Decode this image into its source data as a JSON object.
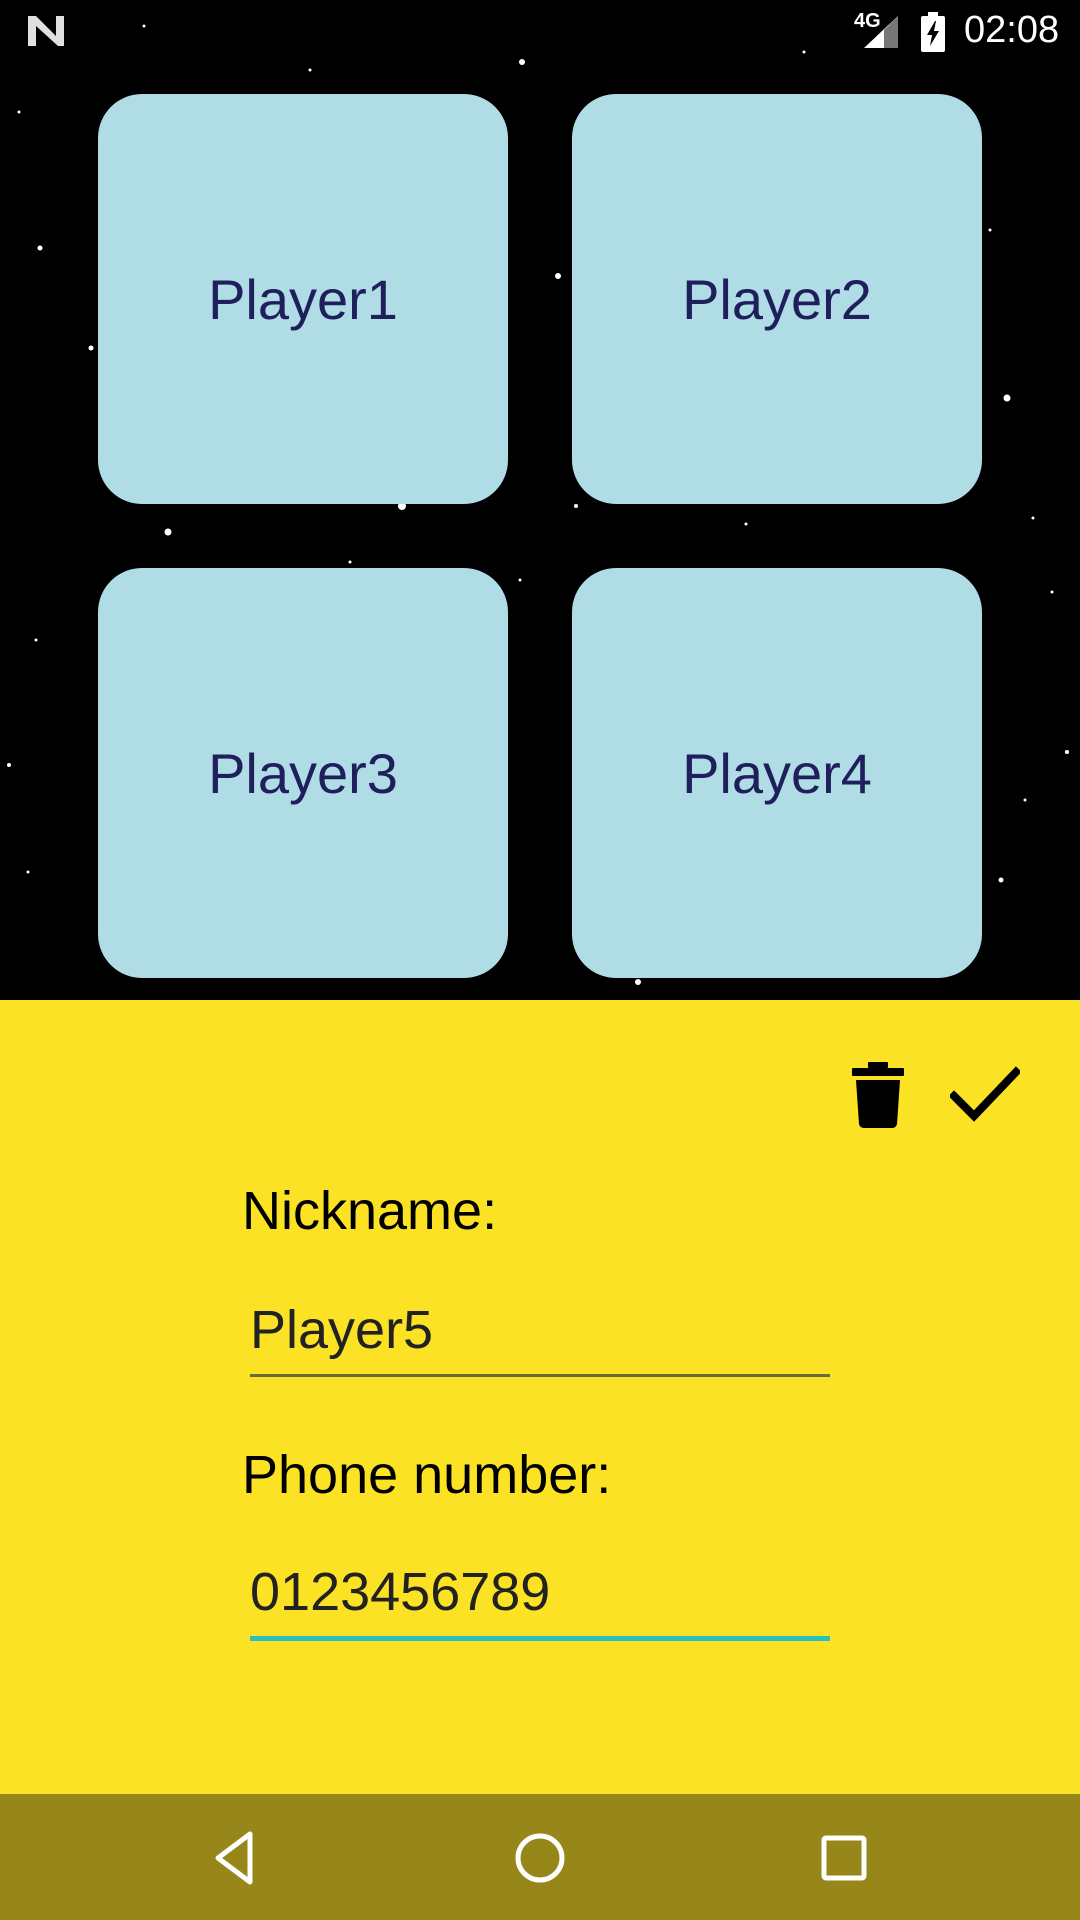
{
  "status_bar": {
    "network": "4G",
    "time": "02:08",
    "icons": [
      "n-logo-icon",
      "signal-icon",
      "battery-charging-icon"
    ]
  },
  "players": [
    {
      "label": "Player1"
    },
    {
      "label": "Player2"
    },
    {
      "label": "Player3"
    },
    {
      "label": "Player4"
    }
  ],
  "sheet": {
    "icons": [
      "delete-icon",
      "check-icon"
    ],
    "nickname_label": "Nickname:",
    "nickname_value": "Player5",
    "phone_label": "Phone number:",
    "phone_value": "0123456789"
  },
  "nav_bar": {
    "icons": [
      "back-icon",
      "home-icon",
      "recents-icon"
    ]
  },
  "colors": {
    "background": "#000000",
    "card": "#b0dce6",
    "card_text": "#1f1f5c",
    "sheet": "#fce224",
    "nav_bar": "#97871a",
    "focused_underline": "#2bbfc0"
  }
}
